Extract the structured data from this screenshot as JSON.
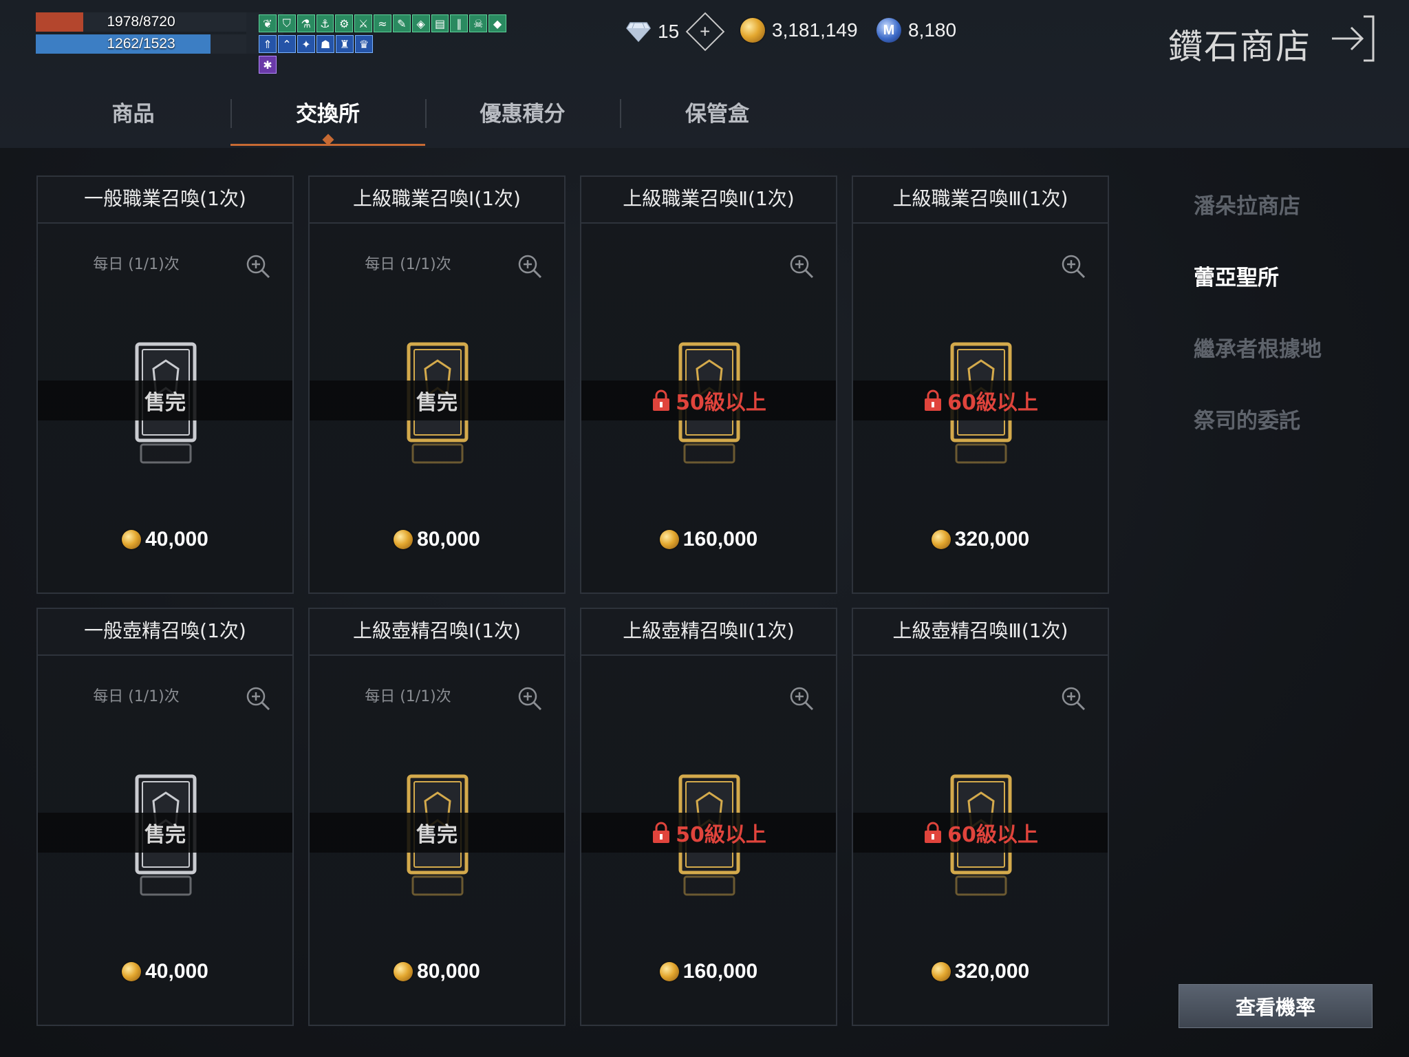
{
  "status": {
    "hp": {
      "text": "1978/8720",
      "fraction": 0.227
    },
    "mp": {
      "text": "1262/1523",
      "fraction": 0.829
    }
  },
  "buffs": {
    "row1": [
      "leaf",
      "shield",
      "flask",
      "anchor",
      "gear",
      "blade",
      "wave",
      "feather",
      "diamond",
      "book",
      "pillar",
      "skull",
      "gem"
    ],
    "row2": [
      "arrow",
      "chevron",
      "star",
      "helm",
      "tower",
      "crown"
    ],
    "row3": [
      "spider"
    ]
  },
  "currency": {
    "diamonds": "15",
    "gold": "3,181,149",
    "m_coin": "8,180",
    "m_letter": "M"
  },
  "header": {
    "title": "鑽石商店"
  },
  "tabs": [
    {
      "label": "商品",
      "active": false
    },
    {
      "label": "交換所",
      "active": true
    },
    {
      "label": "優惠積分",
      "active": false
    },
    {
      "label": "保管盒",
      "active": false
    }
  ],
  "sidenav": [
    {
      "label": "潘朵拉商店",
      "active": false
    },
    {
      "label": "蕾亞聖所",
      "active": true
    },
    {
      "label": "繼承者根據地",
      "active": false
    },
    {
      "label": "祭司的委託",
      "active": false
    }
  ],
  "cards": [
    {
      "title": "一般職業召喚(1次)",
      "daily": "每日 (1/1)次",
      "status": "售完",
      "status_type": "sold",
      "price": "40,000",
      "frame": "silver"
    },
    {
      "title": "上級職業召喚Ⅰ(1次)",
      "daily": "每日 (1/1)次",
      "status": "售完",
      "status_type": "sold",
      "price": "80,000",
      "frame": "gold"
    },
    {
      "title": "上級職業召喚Ⅱ(1次)",
      "daily": "",
      "status": "50級以上",
      "status_type": "locked",
      "price": "160,000",
      "frame": "gold"
    },
    {
      "title": "上級職業召喚Ⅲ(1次)",
      "daily": "",
      "status": "60級以上",
      "status_type": "locked",
      "price": "320,000",
      "frame": "gold"
    },
    {
      "title": "一般壺精召喚(1次)",
      "daily": "每日 (1/1)次",
      "status": "售完",
      "status_type": "sold",
      "price": "40,000",
      "frame": "silver"
    },
    {
      "title": "上級壺精召喚Ⅰ(1次)",
      "daily": "每日 (1/1)次",
      "status": "售完",
      "status_type": "sold",
      "price": "80,000",
      "frame": "gold"
    },
    {
      "title": "上級壺精召喚Ⅱ(1次)",
      "daily": "",
      "status": "50級以上",
      "status_type": "locked",
      "price": "160,000",
      "frame": "gold"
    },
    {
      "title": "上級壺精召喚Ⅲ(1次)",
      "daily": "",
      "status": "60級以上",
      "status_type": "locked",
      "price": "320,000",
      "frame": "gold"
    }
  ],
  "footer": {
    "probability_button": "查看機率"
  },
  "colors": {
    "accent": "#c76a33",
    "lock_red": "#e0443c",
    "hp": "#b4462d",
    "mp": "#3c7ec4"
  }
}
